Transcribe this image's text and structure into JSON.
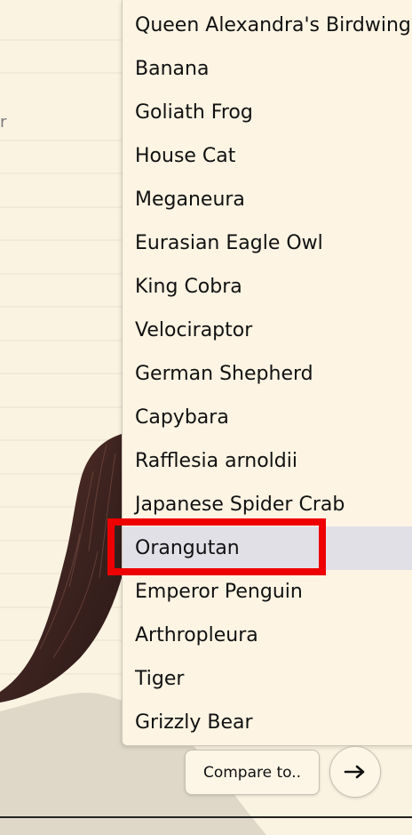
{
  "background": {
    "partial_text": "r"
  },
  "dropdown": {
    "options": [
      "Queen Alexandra's Birdwing",
      "Banana",
      "Goliath Frog",
      "House Cat",
      "Meganeura",
      "Eurasian Eagle Owl",
      "King Cobra",
      "Velociraptor",
      "German Shepherd",
      "Capybara",
      "Rafflesia arnoldii",
      "Japanese Spider Crab",
      "Orangutan",
      "Emperor Penguin",
      "Arthropleura",
      "Tiger",
      "Grizzly Bear"
    ],
    "selected": "Orangutan",
    "selected_bg": "#e2e0e7"
  },
  "controls": {
    "compare_label": "Compare to..",
    "go_icon": "arrow-right-icon"
  },
  "highlight_color": "#ee0000"
}
